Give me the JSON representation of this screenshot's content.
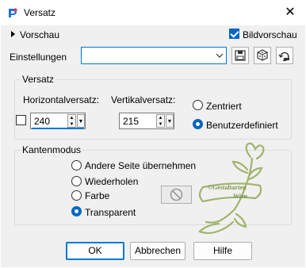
{
  "window": {
    "title": "Versatz",
    "close_glyph": "✕"
  },
  "preview": {
    "label": "Vorschau",
    "bildvorschau_label": "Bildvorschau",
    "bildvorschau_checked": true
  },
  "settings": {
    "label": "Einstellungen",
    "value": ""
  },
  "versatz": {
    "title": "Versatz",
    "horizontal_label": "Horizontalversatz:",
    "horizontal_value": "240",
    "vertical_label": "Vertikalversatz:",
    "vertical_value": "215",
    "zentriert_label": "Zentriert",
    "benutzerdefiniert_label": "Benutzerdefiniert",
    "selected": "Benutzerdefiniert"
  },
  "kantenmodus": {
    "title": "Kantenmodus",
    "options": [
      "Andere Seite übernehmen",
      "Wiederholen",
      "Farbe",
      "Transparent"
    ],
    "selected": "Transparent"
  },
  "watermark": {
    "line1": "©Gestaltarten",
    "line2": "Wien"
  },
  "buttons": {
    "ok": "OK",
    "cancel": "Abbrechen",
    "help": "Hilfe"
  },
  "colors": {
    "accent": "#0078d4",
    "radio_accent": "#0067c0",
    "watermark": "#9fb46a"
  }
}
